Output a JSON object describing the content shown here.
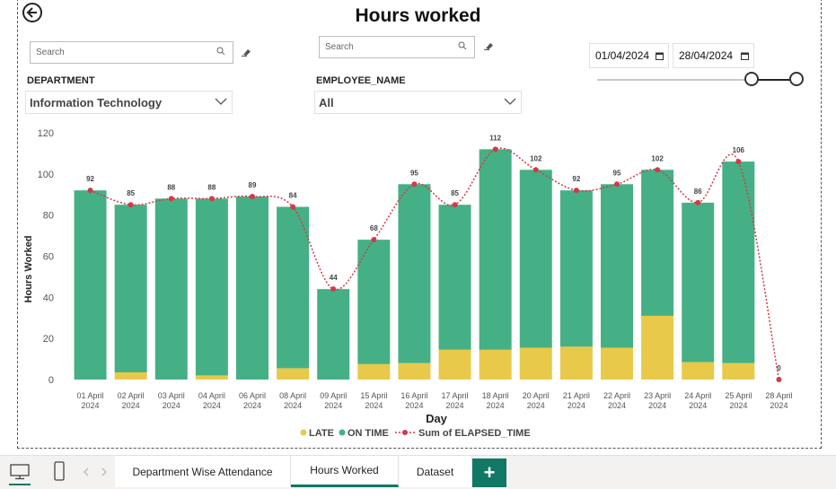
{
  "page": {
    "title": "Hours worked"
  },
  "filters": {
    "search1": {
      "placeholder": "Search"
    },
    "search2": {
      "placeholder": "Search"
    },
    "department": {
      "label": "DEPARTMENT",
      "value": "Information Technology"
    },
    "employee": {
      "label": "EMPLOYEE_NAME",
      "value": "All"
    },
    "date_from": "01/04/2024",
    "date_to": "28/04/2024",
    "date_slider": {
      "start_fraction": 0.78,
      "end_fraction": 1.0
    }
  },
  "chart_data": {
    "type": "bar",
    "stacked": true,
    "xlabel": "Day",
    "ylabel": "Hours Worked",
    "ylim": [
      0,
      120
    ],
    "yticks": [
      0,
      20,
      40,
      60,
      80,
      100,
      120
    ],
    "categories": [
      [
        "01 April",
        "2024"
      ],
      [
        "02 April",
        "2024"
      ],
      [
        "03 April",
        "2024"
      ],
      [
        "04 April",
        "2024"
      ],
      [
        "06 April",
        "2024"
      ],
      [
        "08 April",
        "2024"
      ],
      [
        "09 April",
        "2024"
      ],
      [
        "15 April",
        "2024"
      ],
      [
        "16 April",
        "2024"
      ],
      [
        "17 April",
        "2024"
      ],
      [
        "18 April",
        "2024"
      ],
      [
        "20 April",
        "2024"
      ],
      [
        "21 April",
        "2024"
      ],
      [
        "22 April",
        "2024"
      ],
      [
        "23 April",
        "2024"
      ],
      [
        "24 April",
        "2024"
      ],
      [
        "25 April",
        "2024"
      ],
      [
        "28 April",
        "2024"
      ]
    ],
    "series": [
      {
        "name": "LATE",
        "color": "#E8C94A",
        "values": [
          0,
          3.5,
          0,
          2,
          0,
          5.5,
          0,
          7.5,
          8,
          14.5,
          14.5,
          15.5,
          16,
          15.5,
          31,
          8.5,
          8,
          0
        ]
      },
      {
        "name": "ON TIME",
        "color": "#45B085",
        "values": [
          92,
          81.5,
          88,
          86,
          89,
          78.5,
          44,
          60.5,
          87,
          70.5,
          97.5,
          86.5,
          76,
          79.5,
          71,
          77.5,
          98,
          0
        ]
      },
      {
        "name": "Sum of ELAPSED_TIME",
        "type": "line",
        "color": "#D13A48",
        "values": [
          92,
          85,
          88,
          88,
          89,
          84,
          44,
          68,
          95,
          85,
          112,
          102,
          92,
          95,
          102,
          86,
          106,
          0
        ]
      }
    ],
    "legend": {
      "position": "bottom",
      "items": [
        "LATE",
        "ON TIME",
        "Sum of ELAPSED_TIME"
      ]
    }
  },
  "tabs": {
    "items": [
      {
        "label": "Department Wise Attendance",
        "active": false
      },
      {
        "label": "Hours Worked",
        "active": true
      },
      {
        "label": "Dataset",
        "active": false
      }
    ],
    "add_label": "+"
  },
  "icons": {
    "back": "back-arrow-icon",
    "search": "search-icon",
    "eraser": "eraser-icon",
    "chevron": "chevron-down-icon",
    "calendar": "calendar-icon",
    "desktop": "desktop-icon",
    "mobile": "mobile-icon"
  }
}
